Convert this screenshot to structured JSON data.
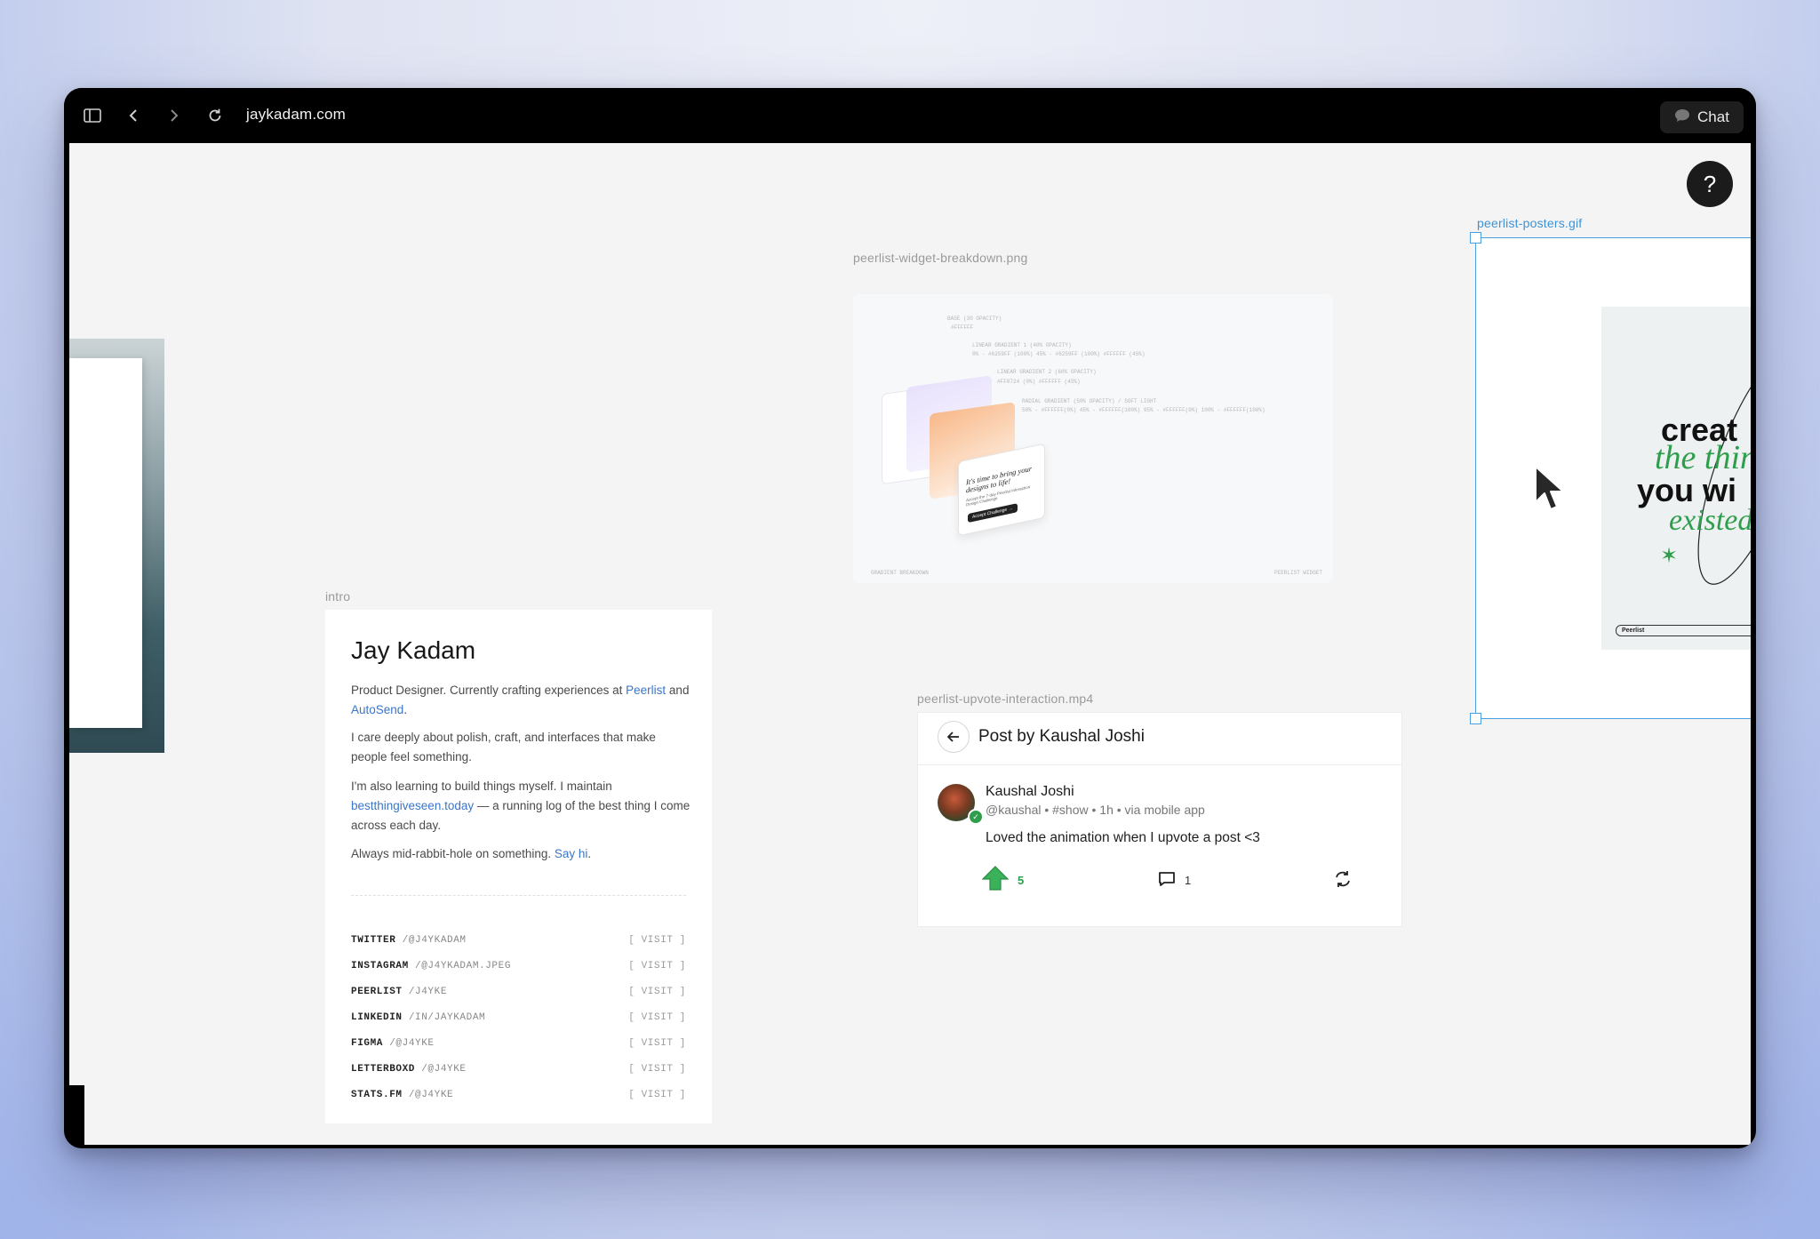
{
  "browser": {
    "url": "jaykadam.com",
    "chat_label": "Chat",
    "icons": [
      "sidebar-icon",
      "back-icon",
      "forward-icon",
      "reload-icon",
      "chat-bubble-icon"
    ]
  },
  "help_label": "?",
  "frames": {
    "breakdown_label": "peerlist-widget-breakdown.png",
    "intro_label": "intro",
    "upvote_label": "peerlist-upvote-interaction.mp4",
    "posters_label": "peerlist-posters.gif"
  },
  "breakdown": {
    "base": "BASE (30 OPACITY)",
    "base_val": "#FFFFFF",
    "lin1": "LINEAR GRADIENT 1 (40% OPACITY)",
    "lin1_vals": "0% - #6259FF (100%)   45% - #6259FF (100%)   #FFFFFF (45%)",
    "lin2": "LINEAR GRADIENT 2 (60% OPACITY)",
    "lin2_vals": "#FF8724 (0%)   #FFFFFF (45%)",
    "radial": "RADIAL GRADIENT (50% OPACITY) / SOFT LIGHT",
    "radial_vals": "50% - #FFFFFF(0%)   45% - #FFFFFF(100%)   95% - #FFFFFF(0%)   100% - #FFFFFF(100%)",
    "card_headline": "It's time to bring your designs to life!",
    "card_sub": "Accept the 7-day Peerlist Interaction Design Challenge",
    "card_button": "Accept Challenge →",
    "footer_left": "GRADIENT BREAKDOWN",
    "footer_right": "PEERLIST WIDGET"
  },
  "intro": {
    "name": "Jay Kadam",
    "p1_a": "Product Designer. Currently crafting experiences at ",
    "p1_link1": "Peerlist",
    "p1_b": " and ",
    "p1_link2": "AutoSend",
    "p1_c": ".",
    "p2": "I care deeply about polish, craft, and interfaces that make people feel something.",
    "p3_a": "I'm also learning to build things myself. I maintain ",
    "p3_link": "bestthingiveseen.today",
    "p3_b": " — a running log of the best thing I come across each day.",
    "p4_a": "Always mid-rabbit-hole on something. ",
    "p4_link": "Say hi",
    "p4_b": ".",
    "socials": [
      {
        "name": "TWITTER",
        "handle": "/@J4YKADAM",
        "action": "[ VISIT ]"
      },
      {
        "name": "INSTAGRAM",
        "handle": "/@J4YKADAM.JPEG",
        "action": "[ VISIT ]"
      },
      {
        "name": "PEERLIST",
        "handle": "/J4YKE",
        "action": "[ VISIT ]"
      },
      {
        "name": "LINKEDIN",
        "handle": "/IN/JAYKADAM",
        "action": "[ VISIT ]"
      },
      {
        "name": "FIGMA",
        "handle": "/@J4YKE",
        "action": "[ VISIT ]"
      },
      {
        "name": "LETTERBOXD",
        "handle": "/@J4YKE",
        "action": "[ VISIT ]"
      },
      {
        "name": "STATS.FM",
        "handle": "/@J4YKE",
        "action": "[ VISIT ]"
      }
    ]
  },
  "post": {
    "title": "Post by Kaushal Joshi",
    "author": "Kaushal Joshi",
    "meta": "@kaushal • #show • 1h • via mobile app",
    "body": "Loved the animation when I upvote a post <3",
    "upvotes": "5",
    "comments": "1"
  },
  "poster": {
    "line1": "creat",
    "line2": "the thin",
    "line3": "you wi",
    "line4": "existed",
    "brand": "Peerlist"
  },
  "colors": {
    "link": "#3a76c8",
    "accent_green": "#2f9e4c",
    "selection_blue": "#4a9fe0"
  }
}
